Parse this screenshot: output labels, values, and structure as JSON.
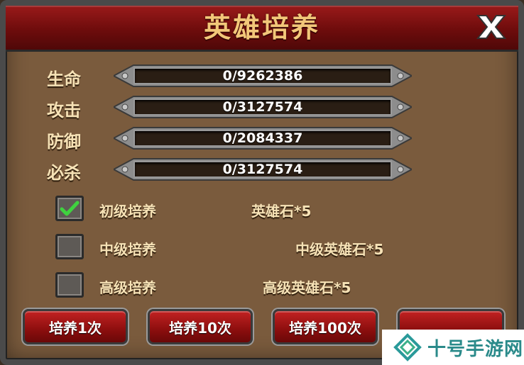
{
  "window": {
    "title": "英雄培养",
    "close_icon": "close-x-icon"
  },
  "stats": [
    {
      "label": "生命",
      "value": "0/9262386"
    },
    {
      "label": "攻击",
      "value": "0/3127574"
    },
    {
      "label": "防御",
      "value": "0/2084337"
    },
    {
      "label": "必杀",
      "value": "0/3127574"
    }
  ],
  "options": [
    {
      "label": "初级培养",
      "cost": "英雄石*5",
      "checked": true
    },
    {
      "label": "中级培养",
      "cost": "中级英雄石*5",
      "checked": false
    },
    {
      "label": "高级培养",
      "cost": "高级英雄石*5",
      "checked": false
    }
  ],
  "buttons": {
    "train_1": "培养1次",
    "train_10": "培养10次",
    "train_100": "培养100次"
  },
  "watermark": {
    "text": "十号手游网"
  },
  "colors": {
    "title_red": "#8c0e0e",
    "panel_brown": "#7a5b3d",
    "label_cream": "#f6e2b6",
    "title_gold": "#f2c779",
    "check_green": "#3fd13f",
    "watermark_teal": "#2a8a8a"
  }
}
